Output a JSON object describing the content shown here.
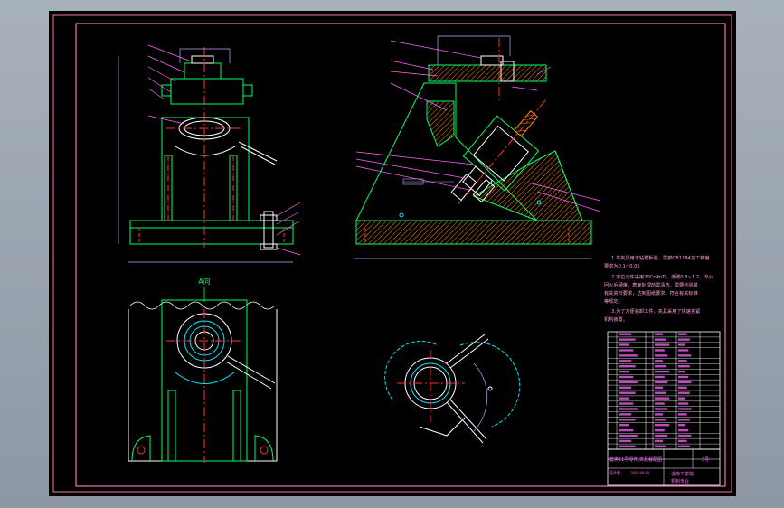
{
  "section_label": "A向",
  "tech_requirements": {
    "lines": [
      "1.本夹具用于钻模板装，需按GB1184加工精度",
      "要求为0.1~0.05",
      "2.定位元件采用20CrMnTi，渗碳0.8~1.2，淬火",
      "回火后硬度，表面处理前需清洗，需要检验其",
      "有关资料要求，达到图纸要求，符合有关标准",
      "等规定。",
      "3.为了方便装卸工件，夹具采用了快速夹紧",
      "机构装置。"
    ]
  },
  "title_block": {
    "drawing_title": "套类11号零件,夹具装配图",
    "sheet_size": "3号",
    "designer_label": "设计者",
    "date": "2005.06.10",
    "school": "湖南工学院",
    "class": "机制专业"
  },
  "colors": {
    "sheet": "#000000",
    "border": "#ff6fb0",
    "outline": "#00ff66",
    "hatch": "#ff8c00",
    "center": "#ff3030",
    "dims": "#b0b0ff",
    "leader": "#ff66ff",
    "white": "#ffffff",
    "cyan": "#00e5ff",
    "yellow": "#ffe600",
    "text": "#ff9cdb"
  }
}
